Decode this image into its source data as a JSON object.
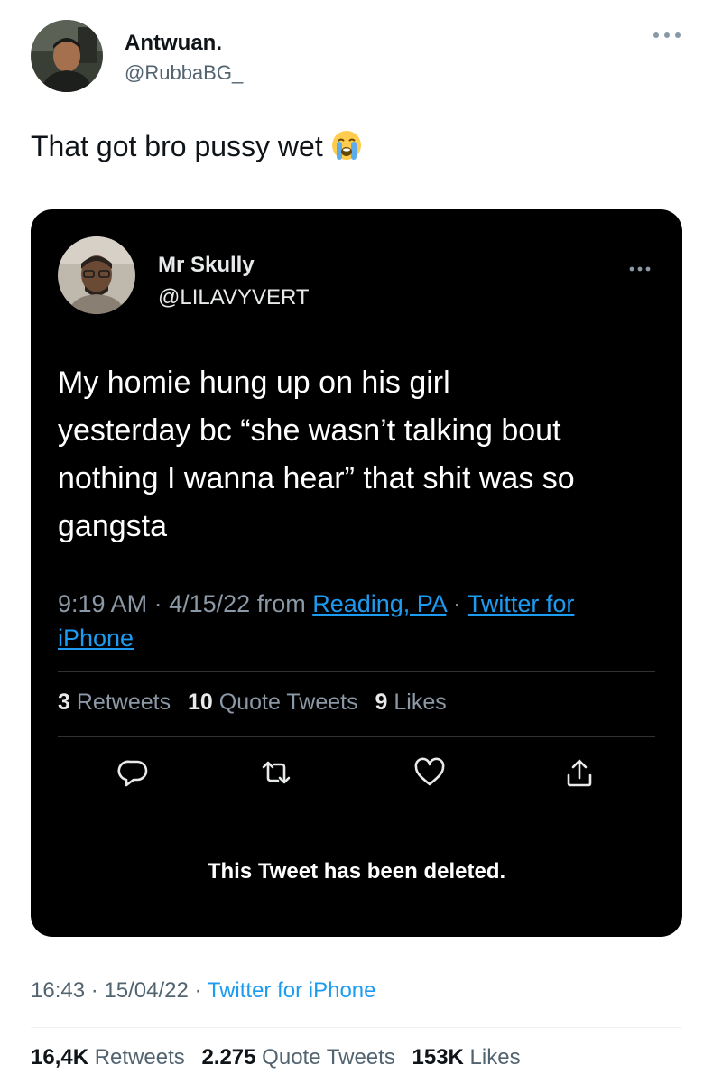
{
  "author": {
    "name": "Antwuan.",
    "handle": "@RubbaBG_"
  },
  "tweet": {
    "text": "That got bro pussy wet",
    "emoji": "loudly-crying-face"
  },
  "quoted_tweet": {
    "author": {
      "name": "Mr Skully",
      "handle": "@LILAVYVERT"
    },
    "text_lines": [
      "My homie hung up on his girl",
      "yesterday bc “she wasn’t talking bout",
      "nothing I wanna hear” that shit was so",
      "gangsta"
    ],
    "time": "9:19 AM",
    "date": "4/15/22",
    "from_label": "from",
    "location": "Reading, PA",
    "source_part1": "Twitter for",
    "source_part2": "iPhone",
    "separator": "·",
    "stats": {
      "retweets_count": "3",
      "retweets_label": "Retweets",
      "quotes_count": "10",
      "quotes_label": "Quote Tweets",
      "likes_count": "9",
      "likes_label": "Likes"
    },
    "actions": [
      "reply-icon",
      "retweet-icon",
      "like-icon",
      "share-icon"
    ],
    "deleted_notice": "This Tweet has been deleted."
  },
  "meta": {
    "time": "16:43",
    "date": "15/04/22",
    "separator": "·",
    "source": "Twitter for iPhone"
  },
  "stats": {
    "retweets_count": "16,4K",
    "retweets_label": "Retweets",
    "quotes_count": "2.275",
    "quotes_label": "Quote Tweets",
    "likes_count": "153K",
    "likes_label": "Likes"
  },
  "colors": {
    "link_blue": "#1d9bf0",
    "card_bg": "#000000",
    "secondary_text": "#536471"
  }
}
